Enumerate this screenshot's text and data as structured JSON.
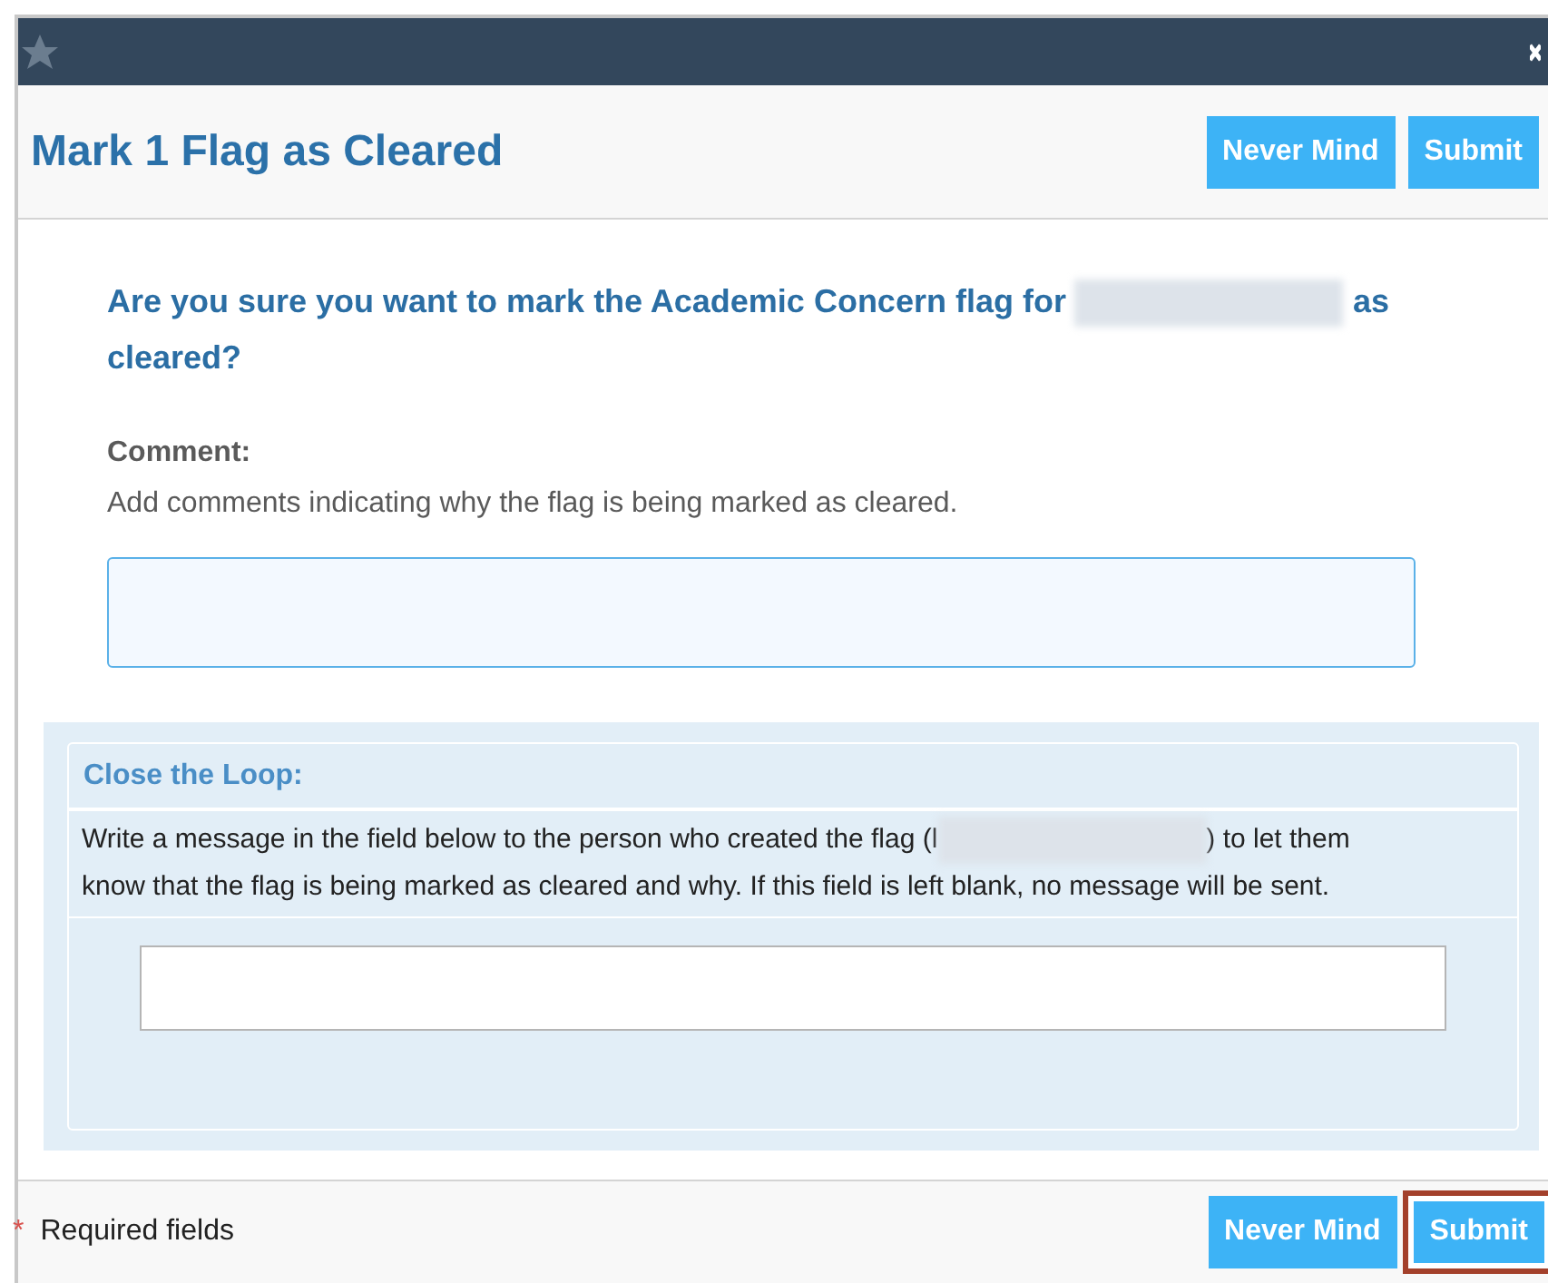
{
  "dialog": {
    "title": "Mark 1 Flag as Cleared",
    "header_buttons": [
      "Never Mind",
      "Submit"
    ],
    "question": [
      {
        "kind": "text",
        "text": "Are you sure you want to mark the Academic Concern flag for "
      },
      {
        "kind": "redacted"
      },
      {
        "kind": "text",
        "text": " as cleared?"
      }
    ],
    "comment": {
      "label": "Comment:",
      "hint": "Add comments indicating why the flag is being marked as cleared.",
      "focused": true
    },
    "close_the_loop": {
      "title": "Close the Loop:",
      "message": [
        {
          "kind": "text",
          "text": "Write a message in the field below to the person who created the flag (l"
        },
        {
          "kind": "redacted"
        },
        {
          "kind": "text",
          "text": ") to let them know that the flag is being marked as cleared and why. If this field is left blank, no message will be sent."
        }
      ]
    },
    "footer": {
      "required_mark": "*",
      "required_text": "Required fields",
      "buttons": [
        {
          "label": "Never Mind",
          "highlighted": false
        },
        {
          "label": "Submit",
          "highlighted": true
        }
      ]
    }
  }
}
